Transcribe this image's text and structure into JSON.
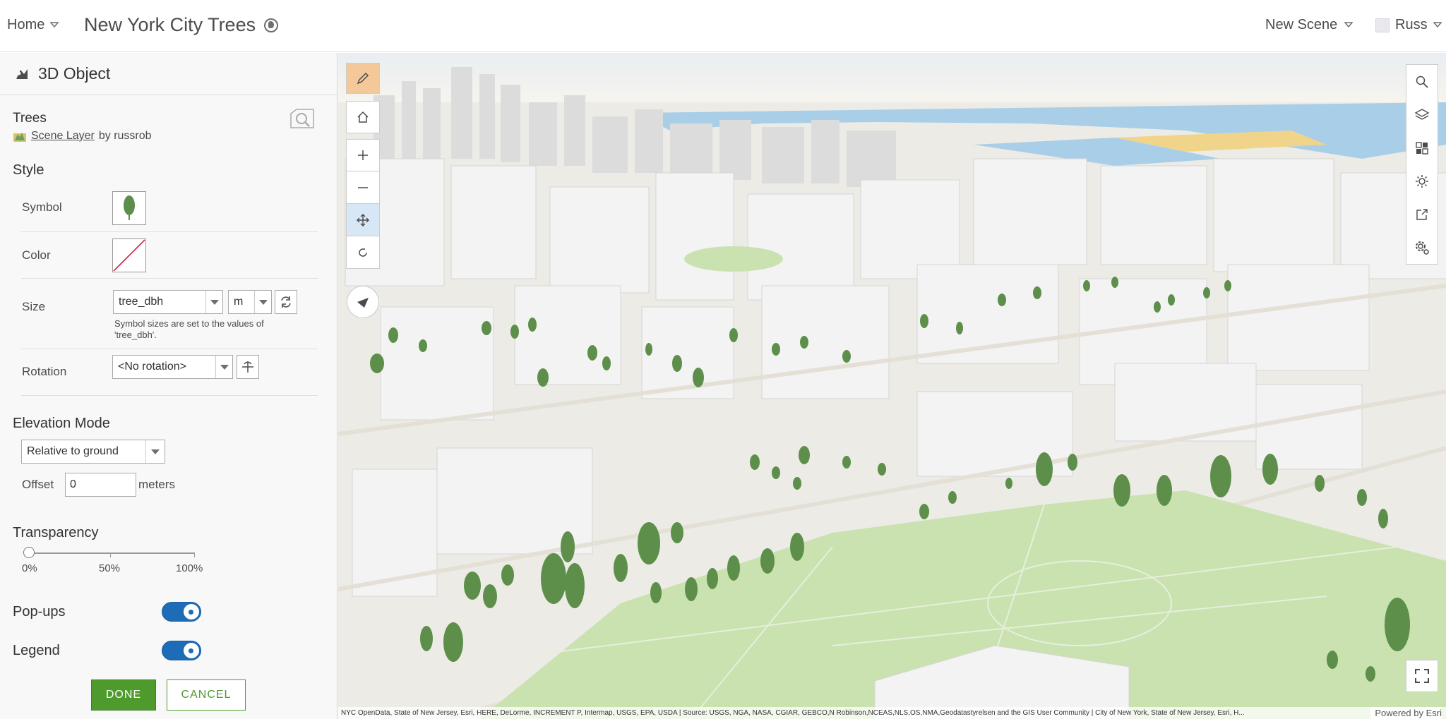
{
  "topbar": {
    "home_label": "Home",
    "title": "New York City Trees",
    "new_scene_label": "New Scene",
    "user_name": "Russ"
  },
  "panel": {
    "header_title": "3D Object",
    "layer_name": "Trees",
    "layer_link": "Scene Layer",
    "layer_owner": "by russrob",
    "style_title": "Style",
    "symbol_label": "Symbol",
    "color_label": "Color",
    "size_label": "Size",
    "size_field": "tree_dbh",
    "size_unit": "m",
    "size_hint": "Symbol sizes are set to the values of 'tree_dbh'.",
    "rotation_label": "Rotation",
    "rotation_value": "<No rotation>",
    "elevation_title": "Elevation Mode",
    "elevation_value": "Relative to ground",
    "offset_label": "Offset",
    "offset_value": "0",
    "offset_unit": "meters",
    "transparency_title": "Transparency",
    "transparency_value": 0,
    "transparency_ticks": [
      "0%",
      "50%",
      "100%"
    ],
    "popups_label": "Pop-ups",
    "popups_on": true,
    "legend_label": "Legend",
    "legend_on": true,
    "done_label": "DONE",
    "cancel_label": "CANCEL"
  },
  "map": {
    "attribution": "NYC OpenData, State of New Jersey, Esri, HERE, DeLorme, INCREMENT P, Intermap, USGS, EPA, USDA | Source: USGS, NGA, NASA, CGIAR, GEBCO,N Robinson,NCEAS,NLS,OS,NMA,Geodatastyrelsen and the GIS User Community | City of New York, State of New Jersey, Esri, H...",
    "powered_by": "Powered by Esri"
  },
  "colors": {
    "accent": "#4e9a2d",
    "toggle": "#1e6bb8",
    "park": "#c9e2b0",
    "tree": "#5d8f4a",
    "building": "#f2f2f2",
    "edit_tool": "#f5c89a"
  }
}
